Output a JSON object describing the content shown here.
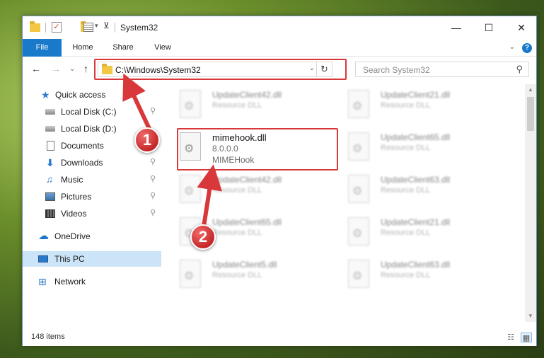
{
  "window": {
    "title": "System32",
    "minimize": "—",
    "maximize": "☐",
    "close": "✕"
  },
  "ribbon": {
    "tabs": [
      "File",
      "Home",
      "Share",
      "View"
    ],
    "chevron": "⌄",
    "help": "?"
  },
  "nav": {
    "back": "←",
    "forward": "→",
    "recent": "⌄",
    "up": "↑"
  },
  "address": {
    "path": "C:\\Windows\\System32",
    "dropdown": "⌄",
    "refresh": "↻"
  },
  "search": {
    "placeholder": "Search System32",
    "icon": "⚲"
  },
  "sidebar": {
    "items": [
      {
        "label": "Quick access",
        "icon": "star-icon",
        "pinned": false
      },
      {
        "label": "Local Disk (C:)",
        "icon": "disk-icon",
        "pinned": true
      },
      {
        "label": "Local Disk (D:)",
        "icon": "disk-icon",
        "pinned": false
      },
      {
        "label": "Documents",
        "icon": "document-icon",
        "pinned": true
      },
      {
        "label": "Downloads",
        "icon": "download-icon",
        "pinned": true
      },
      {
        "label": "Music",
        "icon": "music-icon",
        "pinned": true
      },
      {
        "label": "Pictures",
        "icon": "pictures-icon",
        "pinned": true
      },
      {
        "label": "Videos",
        "icon": "videos-icon",
        "pinned": true
      },
      {
        "label": "OneDrive",
        "icon": "onedrive-icon",
        "pinned": false
      },
      {
        "label": "This PC",
        "icon": "this-pc-icon",
        "pinned": false,
        "selected": true
      },
      {
        "label": "Network",
        "icon": "network-icon",
        "pinned": false
      }
    ],
    "pin_glyph": "📌"
  },
  "files": [
    {
      "name": "UpdateClient42.dll",
      "type": "Resource DLL"
    },
    {
      "name": "UpdateClient21.dll",
      "type": "Resource DLL"
    },
    {
      "name": "mimehook.dll",
      "version": "8.0.0.0",
      "description": "MIMEHook"
    },
    {
      "name": "UpdateClient65.dll",
      "type": "Resource DLL"
    },
    {
      "name": "UpdateClient42.dll",
      "type": "Resource DLL"
    },
    {
      "name": "UpdateClient63.dll",
      "type": "Resource DLL"
    },
    {
      "name": "UpdateClient65.dll",
      "type": "Resource DLL"
    },
    {
      "name": "UpdateClient21.dll",
      "type": "Resource DLL"
    },
    {
      "name": "UpdateClient5.dll",
      "type": "Resource DLL"
    },
    {
      "name": "UpdateClient63.dll",
      "type": "Resource DLL"
    }
  ],
  "status": {
    "item_count": "148 items",
    "details_view": "☷",
    "tiles_view": "▦"
  },
  "annotations": {
    "step1": "1",
    "step2": "2",
    "color": "#d9383a"
  }
}
